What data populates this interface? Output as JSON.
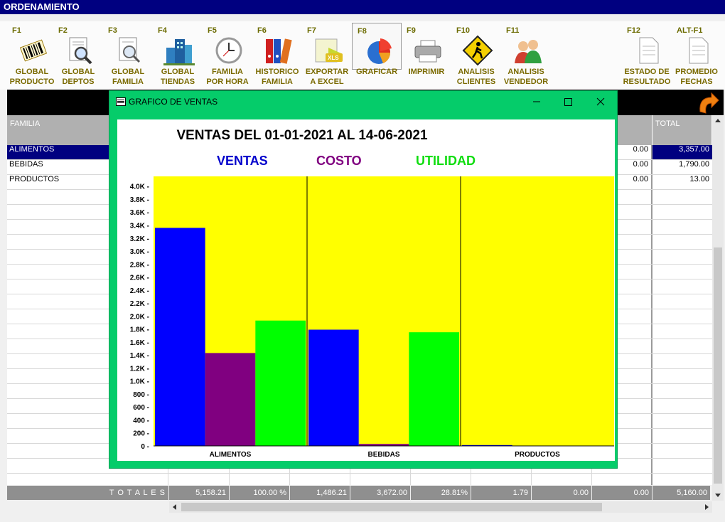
{
  "window": {
    "title": "ORDENAMIENTO"
  },
  "toolbar": {
    "buttons": [
      {
        "key": "F1",
        "label": "GLOBAL\nPRODUCTO",
        "icon": "barcode-icon"
      },
      {
        "key": "F2",
        "label": "GLOBAL\nDEPTOS",
        "icon": "document-search-icon"
      },
      {
        "key": "F3",
        "label": "GLOBAL\nFAMILIA",
        "icon": "document-search-icon"
      },
      {
        "key": "F4",
        "label": "GLOBAL\nTIENDAS",
        "icon": "buildings-icon"
      },
      {
        "key": "F5",
        "label": "FAMILIA\nPOR HORA",
        "icon": "clock-icon"
      },
      {
        "key": "F6",
        "label": "HISTORICO\nFAMILIA",
        "icon": "binders-icon"
      },
      {
        "key": "F7",
        "label": "EXPORTAR\nA EXCEL",
        "icon": "excel-icon"
      },
      {
        "key": "F8",
        "label": "GRAFICAR",
        "icon": "pie-chart-icon"
      },
      {
        "key": "F9",
        "label": "IMPRIMIR",
        "icon": "printer-icon"
      },
      {
        "key": "F10",
        "label": "ANALISIS\nCLIENTES",
        "icon": "pedestrian-sign-icon"
      },
      {
        "key": "F11",
        "label": "ANALISIS\nVENDEDOR",
        "icon": "people-icon"
      },
      {
        "key": "F12",
        "label": "ESTADO DE\nRESULTADO",
        "icon": "document-icon"
      },
      {
        "key": "ALT-F1",
        "label": "PROMEDIO\nFECHAS",
        "icon": "document-icon"
      }
    ]
  },
  "grid": {
    "headers": {
      "familia": "FAMILIA",
      "total": "TOTAL"
    },
    "rows": [
      {
        "familia": "ALIMENTOS",
        "col8": "0.00",
        "total": "3,357.00"
      },
      {
        "familia": "BEBIDAS",
        "col8": "0.00",
        "total": "1,790.00"
      },
      {
        "familia": "PRODUCTOS",
        "col8": "0.00",
        "total": "13.00"
      }
    ],
    "totals": [
      "T O T A L E S",
      "5,158.21",
      "100.00 %",
      "1,486.21",
      "3,672.00",
      "28.81%",
      "1.79",
      "0.00",
      "0.00",
      "5,160.00"
    ]
  },
  "dialog": {
    "title": "GRAFICO DE VENTAS",
    "controls": {
      "minimize": "—",
      "maximize": "☐",
      "close": "✕"
    }
  },
  "colors": {
    "titlebar": "#000080",
    "dialog": "#05cc6a",
    "plot_background": "#ffff00",
    "ventas": "#0000ff",
    "costo": "#800080",
    "utilidad": "#00ff00",
    "selected_row": "#000080"
  },
  "chart_data": {
    "type": "bar",
    "title": "VENTAS DEL 01-01-2021 AL 14-06-2021",
    "categories": [
      "ALIMENTOS",
      "BEBIDAS",
      "PRODUCTOS"
    ],
    "series": [
      {
        "name": "VENTAS",
        "values": [
          3357,
          1790,
          13
        ]
      },
      {
        "name": "COSTO",
        "values": [
          1430,
          30,
          0
        ]
      },
      {
        "name": "UTILIDAD",
        "values": [
          1930,
          1750,
          0
        ]
      }
    ],
    "ylim": [
      0,
      4150
    ],
    "yticks": [
      0,
      200,
      400,
      600,
      800,
      1000,
      1200,
      1400,
      1600,
      1800,
      2000,
      2200,
      2400,
      2600,
      2800,
      3000,
      3200,
      3400,
      3600,
      3800,
      4000
    ],
    "ytick_labels": [
      "0",
      "200",
      "400",
      "600",
      "800",
      "1.0K",
      "1.2K",
      "1.4K",
      "1.6K",
      "1.8K",
      "2.0K",
      "2.2K",
      "2.4K",
      "2.6K",
      "2.8K",
      "3.0K",
      "3.2K",
      "3.4K",
      "3.6K",
      "3.8K",
      "4.0K"
    ],
    "legend": "top",
    "grid": false
  }
}
